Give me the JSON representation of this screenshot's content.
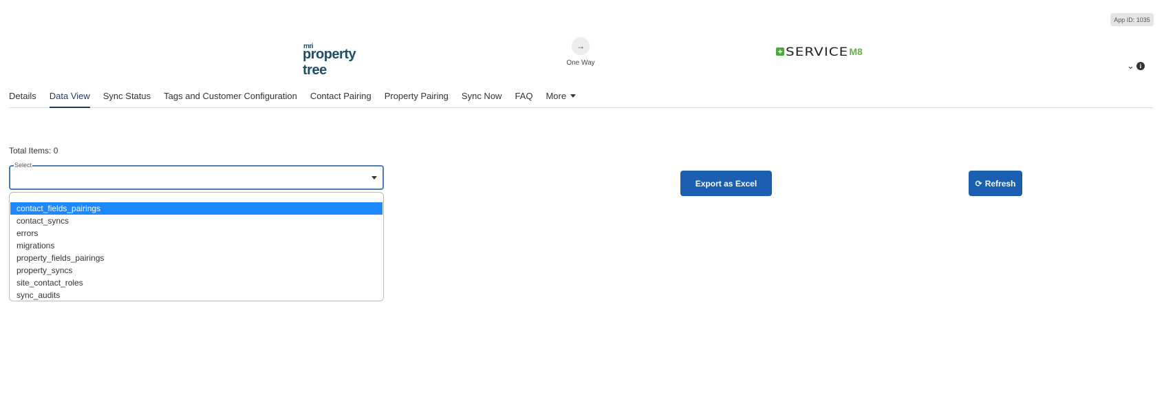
{
  "app_id": "App ID: 1035",
  "header": {
    "left_logo": {
      "prefix": "mri",
      "name": "property tree"
    },
    "direction": {
      "icon": "arrow-right-icon",
      "glyph": "→",
      "label": "One Way"
    },
    "right_logo": {
      "name": "SERVICE",
      "suffix": "M8"
    },
    "icons": [
      {
        "name": "collapse-icon",
        "glyph": "⌄"
      },
      {
        "name": "info-icon",
        "glyph": "i"
      }
    ]
  },
  "tabs": [
    {
      "label": "Details",
      "active": false
    },
    {
      "label": "Data View",
      "active": true
    },
    {
      "label": "Sync Status",
      "active": false
    },
    {
      "label": "Tags and Customer Configuration",
      "active": false
    },
    {
      "label": "Contact Pairing",
      "active": false
    },
    {
      "label": "Property Pairing",
      "active": false
    },
    {
      "label": "Sync Now",
      "active": false
    },
    {
      "label": "FAQ",
      "active": false
    },
    {
      "label": "More",
      "active": false
    }
  ],
  "data_view": {
    "total_items": "Total Items: 0",
    "select": {
      "legend": "Select",
      "value": "",
      "options": [
        "contact_fields_pairings",
        "contact_syncs",
        "errors",
        "migrations",
        "property_fields_pairings",
        "property_syncs",
        "site_contact_roles",
        "sync_audits"
      ],
      "highlighted_index": 0
    },
    "export_label": "Export as Excel",
    "refresh_label": "Refresh",
    "refresh_icon": "refresh-icon"
  },
  "colors": {
    "primary_button": "#1b5fb3",
    "active_tab": "#1b3a5c",
    "highlight_option": "#1e88ff",
    "brand_green": "#6ab04c"
  }
}
